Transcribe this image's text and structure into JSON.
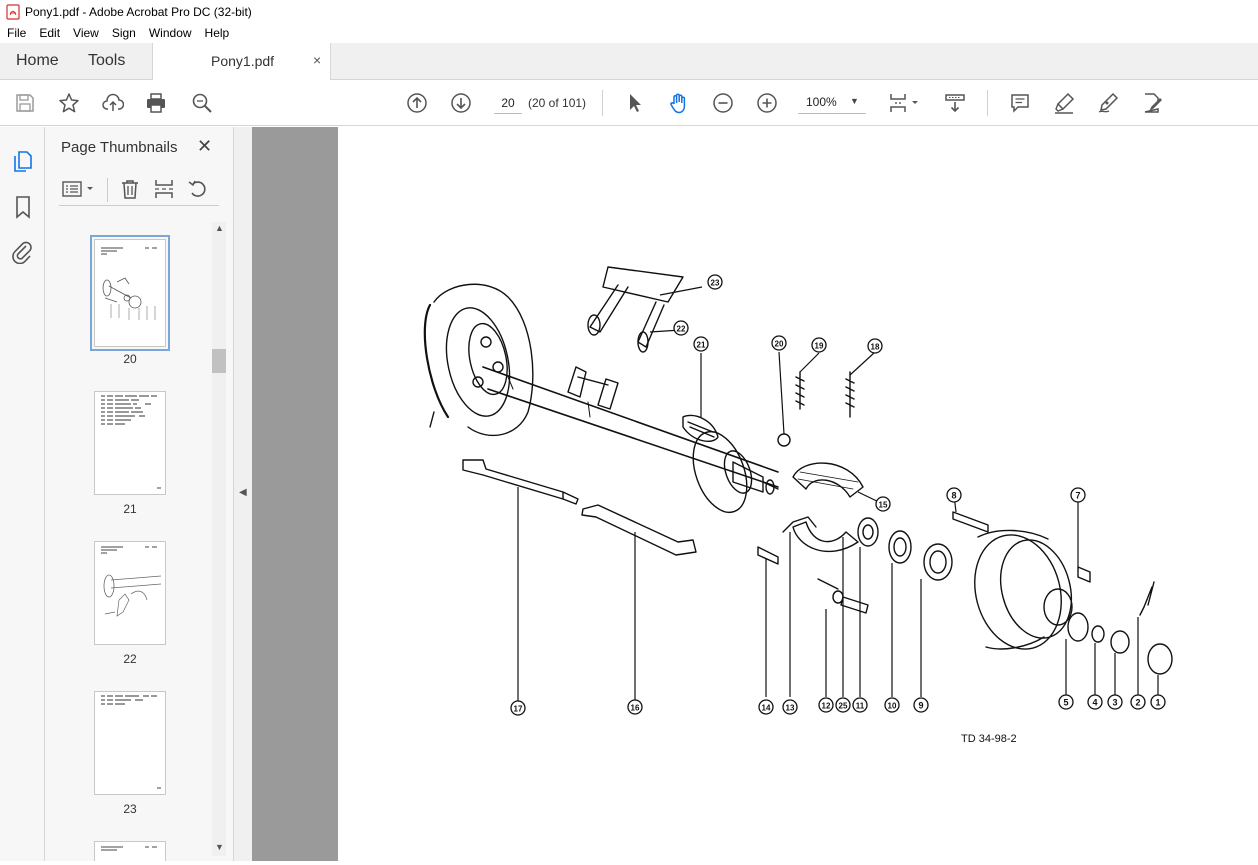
{
  "window": {
    "title": "Pony1.pdf - Adobe Acrobat Pro DC (32-bit)"
  },
  "menu": [
    "File",
    "Edit",
    "View",
    "Sign",
    "Window",
    "Help"
  ],
  "tabs": {
    "home": "Home",
    "tools": "Tools",
    "document": "Pony1.pdf",
    "close": "×"
  },
  "toolbar": {
    "page_number": "20",
    "page_of": "(20 of 101)",
    "zoom": "100%"
  },
  "icons": {
    "left_group": [
      "save-icon",
      "star-icon",
      "upload-cloud-icon",
      "print-icon",
      "search-zoom-icon"
    ],
    "nav": [
      "page-up-icon",
      "page-down-icon"
    ],
    "tools": [
      "select-arrow-icon",
      "hand-tool-icon",
      "zoom-out-icon",
      "zoom-in-icon"
    ],
    "view": [
      "page-display-icon",
      "scroll-mode-icon"
    ],
    "right_group": [
      "comment-icon",
      "highlight-icon",
      "fill-sign-icon",
      "edit-pdf-icon"
    ],
    "rail": [
      "page-thumbnails-icon",
      "bookmark-icon",
      "attachment-icon"
    ]
  },
  "panel": {
    "title": "Page Thumbnails",
    "close": "✕",
    "thumbnails": [
      {
        "label": "20",
        "selected": true
      },
      {
        "label": "21",
        "selected": false
      },
      {
        "label": "22",
        "selected": false
      },
      {
        "label": "23",
        "selected": false
      }
    ]
  },
  "document": {
    "callouts": [
      "1",
      "2",
      "3",
      "4",
      "5",
      "7",
      "8",
      "9",
      "10",
      "11",
      "25",
      "12",
      "13",
      "14",
      "15",
      "16",
      "17",
      "18",
      "19",
      "20",
      "21",
      "22",
      "23"
    ],
    "drawing_code": "TD 34-98-2"
  },
  "colors": {
    "accent": "#1473e6",
    "page_bg": "#9a9a9a",
    "selection": "#7aa7d8"
  }
}
